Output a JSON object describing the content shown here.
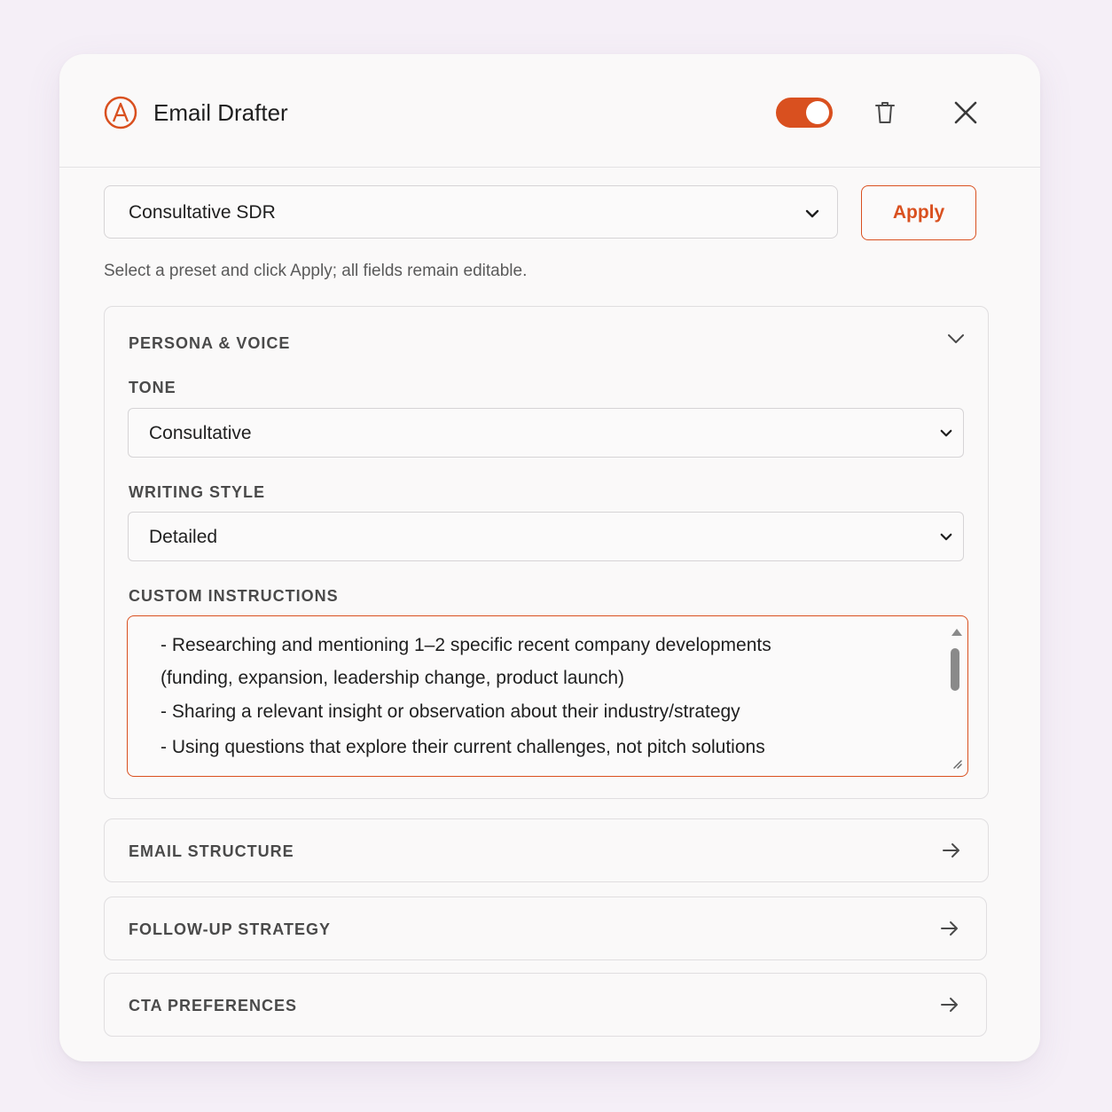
{
  "header": {
    "title": "Email Drafter",
    "toggle_on": true,
    "logo_icon": "anthropic-a-logo",
    "delete_icon": "trash-icon",
    "close_icon": "close-icon"
  },
  "preset": {
    "selected": "Consultative SDR",
    "apply_label": "Apply",
    "helper_text": "Select a preset and click Apply; all fields remain editable."
  },
  "persona": {
    "section_title": "PERSONA & VOICE",
    "tone_label": "TONE",
    "tone_value": "Consultative",
    "style_label": "WRITING STYLE",
    "style_value": "Detailed",
    "instructions_label": "CUSTOM INSTRUCTIONS",
    "instructions_lines": [
      "- Researching and mentioning 1–2 specific recent company developments",
      "(funding, expansion, leadership change, product launch)",
      "- Sharing a relevant insight or observation about their industry/strategy",
      "- Using questions that explore their current challenges, not pitch solutions"
    ]
  },
  "sections": [
    {
      "label": "EMAIL STRUCTURE"
    },
    {
      "label": "FOLLOW-UP STRATEGY"
    },
    {
      "label": "CTA PREFERENCES"
    }
  ],
  "colors": {
    "accent": "#d9501f",
    "background": "#f5eff7",
    "panel": "#faf9f9"
  }
}
